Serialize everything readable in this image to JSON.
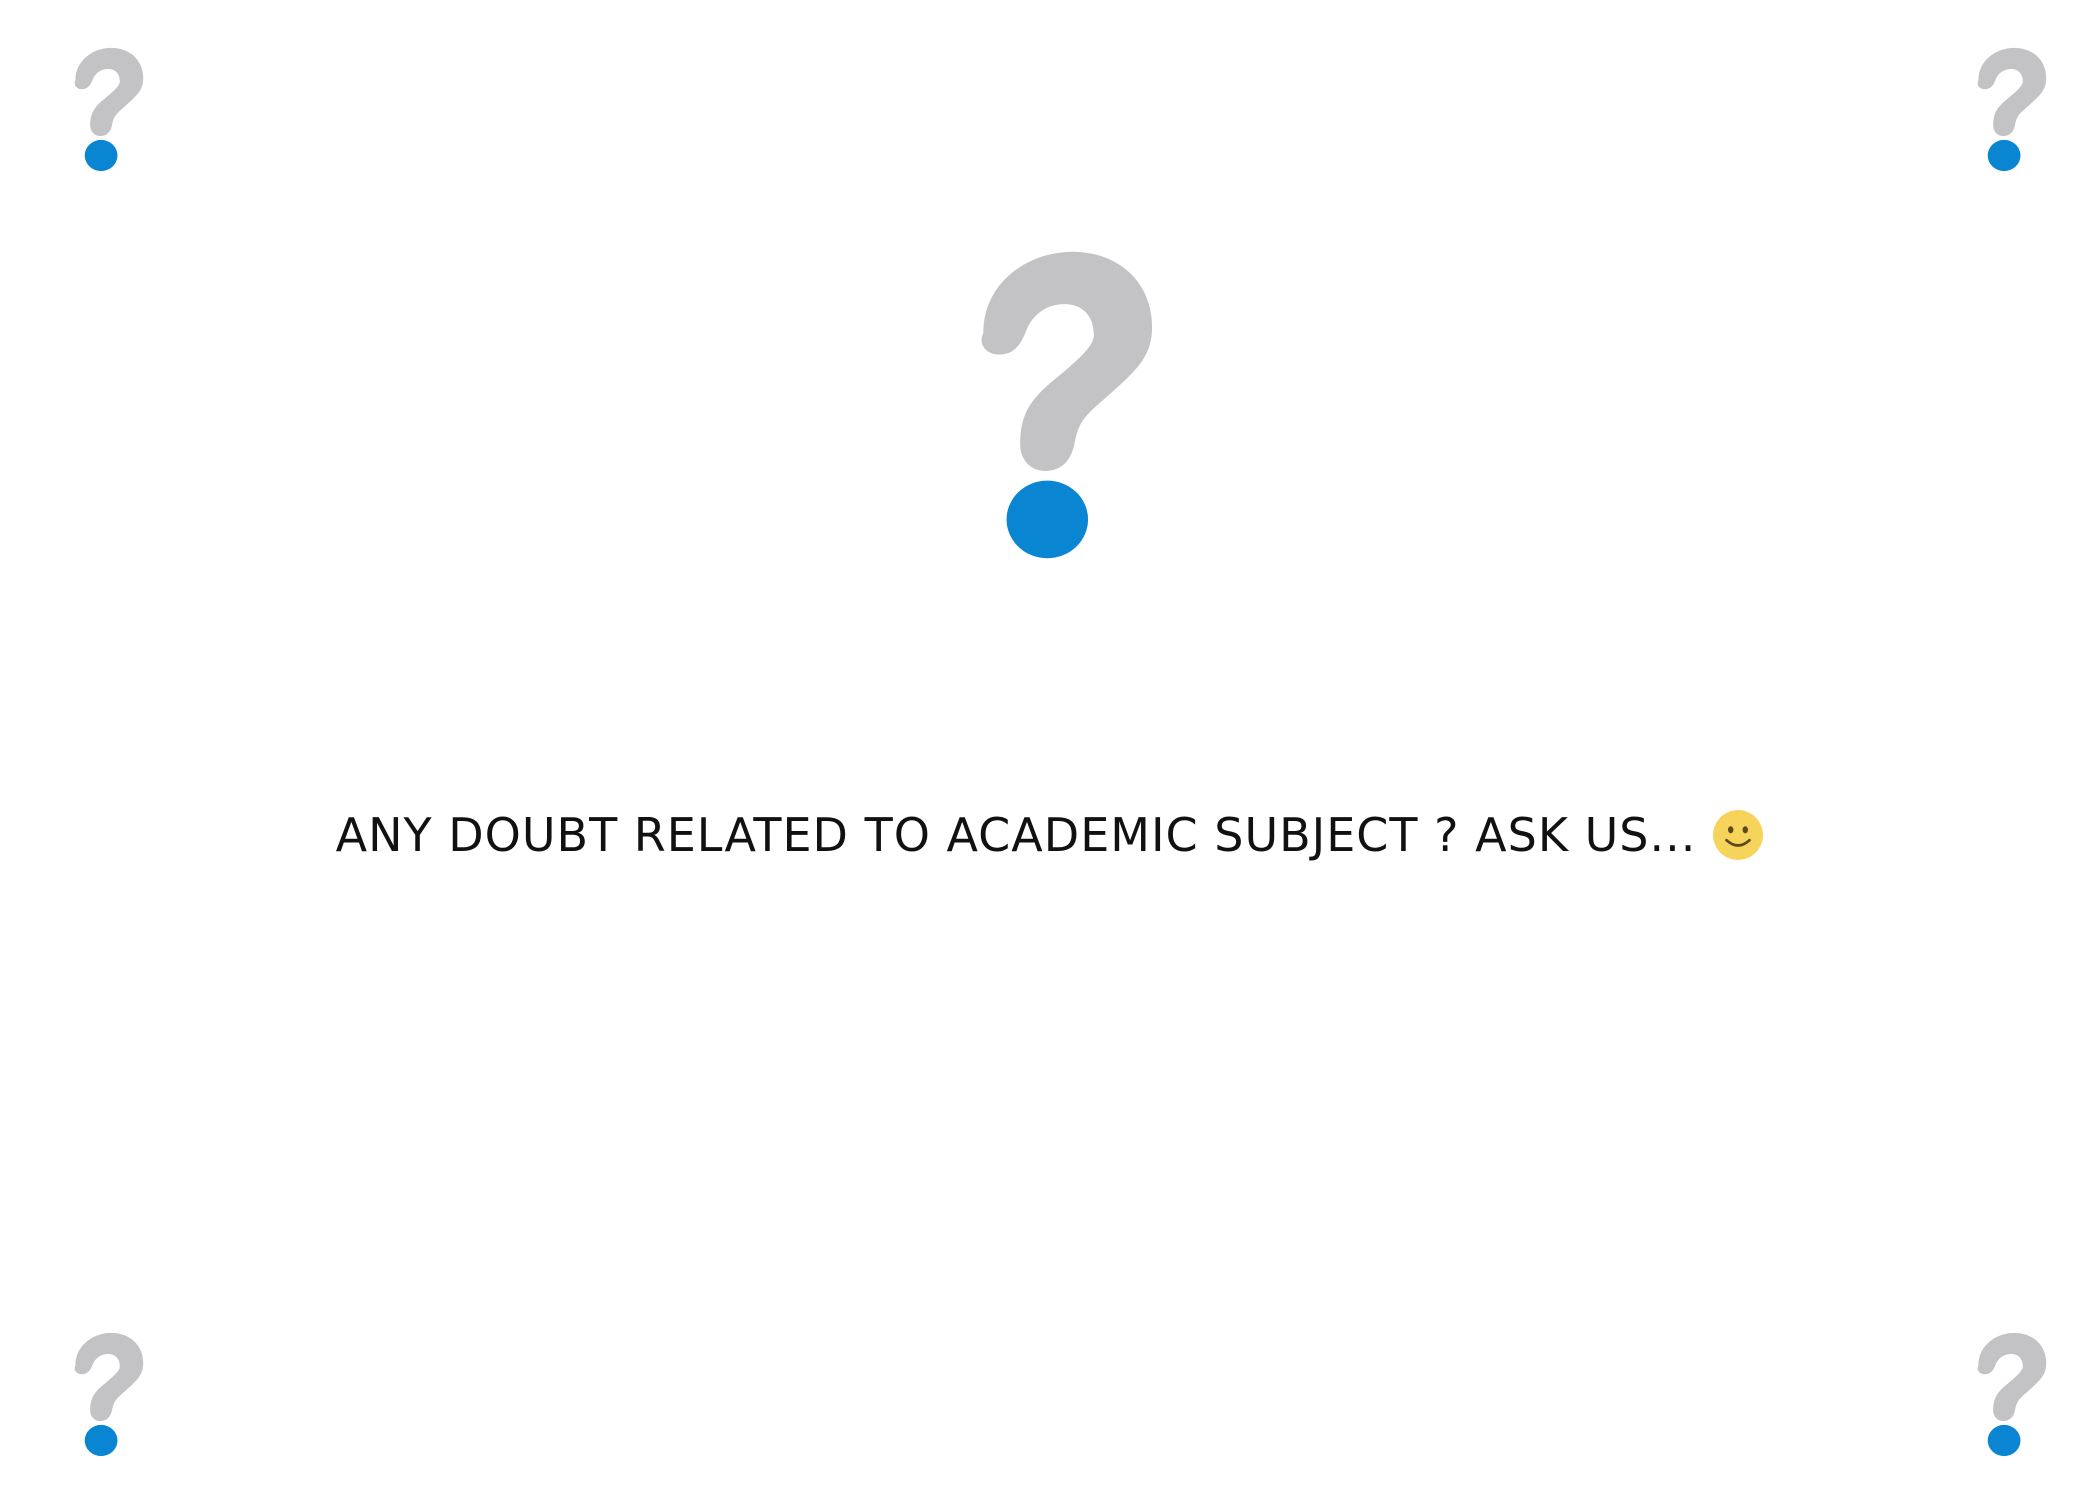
{
  "tagline": {
    "text": "ANY DOUBT RELATED TO ACADEMIC SUBJECT ? ASK US..."
  },
  "icons": {
    "question_mark": "question-mark-icon",
    "smiley": "smiley-icon"
  },
  "colors": {
    "background": "#ffffff",
    "question_hook": "#c3c3c5",
    "question_dot": "#0a85d1",
    "text": "#111111",
    "smiley_face": "#f6d35a",
    "smiley_features": "#5b4a1a"
  }
}
